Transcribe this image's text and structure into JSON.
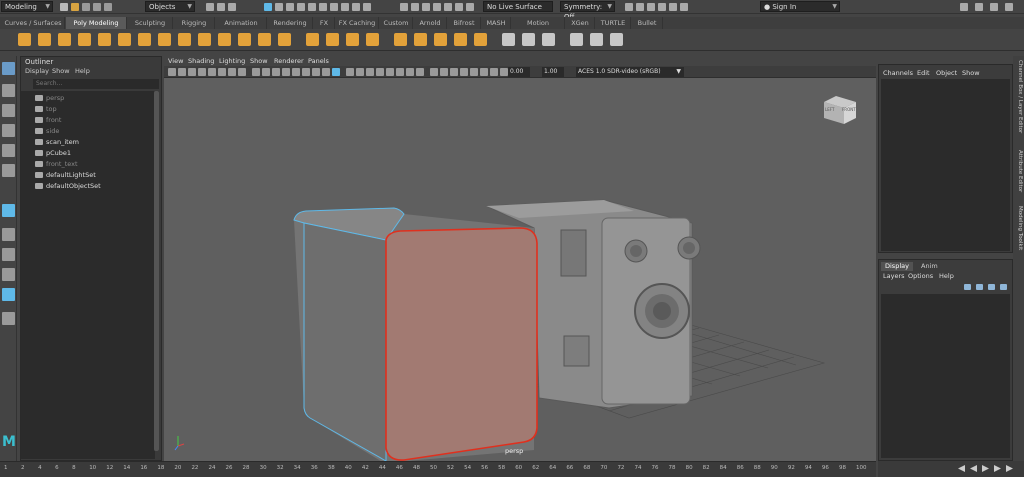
{
  "statusline": {
    "menuset": "Modeling",
    "selection_mode": "Objects",
    "live_surface": "No Live Surface",
    "symmetry": "Symmetry: Off",
    "sign_in": "Sign In"
  },
  "shelf_tabs": [
    "Curves / Surfaces",
    "Poly Modeling",
    "Sculpting",
    "Rigging",
    "Animation",
    "Rendering",
    "FX",
    "FX Caching",
    "Custom",
    "Arnold",
    "Bifrost",
    "MASH",
    "Motion Graphics",
    "XGen",
    "TURTLE",
    "Bullet"
  ],
  "shelf_active": "Poly Modeling",
  "outliner": {
    "title": "Outliner",
    "menu": [
      "Display",
      "Show",
      "Help"
    ],
    "search_placeholder": "Search...",
    "items": [
      {
        "label": "persp",
        "dim": true
      },
      {
        "label": "top",
        "dim": true
      },
      {
        "label": "front",
        "dim": true
      },
      {
        "label": "side",
        "dim": true
      },
      {
        "label": "scan_item",
        "dim": false
      },
      {
        "label": "pCube1",
        "dim": false
      },
      {
        "label": "front_text",
        "dim": true
      },
      {
        "label": "defaultLightSet",
        "dim": false
      },
      {
        "label": "defaultObjectSet",
        "dim": false
      }
    ]
  },
  "viewport": {
    "menu": [
      "View",
      "Shading",
      "Lighting",
      "Show",
      "Renderer",
      "Panels"
    ],
    "exposure": "0.00",
    "gamma": "1.00",
    "color_space": "ACES 1.0 SDR-video (sRGB)",
    "camera_label": "persp",
    "viewcube": {
      "left": "LEFT",
      "front": "FRONT"
    }
  },
  "channelbox": {
    "menu": [
      "Channels",
      "Edit",
      "Object",
      "Show"
    ]
  },
  "layers": {
    "tabs": [
      "Display",
      "Anim"
    ],
    "active_tab": "Display",
    "menu": [
      "Layers",
      "Options",
      "Help"
    ]
  },
  "side_tabs": [
    "Channel Box / Layer Editor",
    "Attribute Editor",
    "Modeling Toolkit"
  ],
  "timeline": {
    "ticks": [
      "1",
      "2",
      "4",
      "6",
      "8",
      "10",
      "12",
      "14",
      "16",
      "18",
      "20",
      "22",
      "24",
      "26",
      "28",
      "30",
      "32",
      "34",
      "36",
      "38",
      "40",
      "42",
      "44",
      "46",
      "48",
      "50",
      "52",
      "54",
      "56",
      "58",
      "60",
      "62",
      "64",
      "66",
      "68",
      "70",
      "72",
      "74",
      "76",
      "78",
      "80",
      "82",
      "84",
      "86",
      "88",
      "90",
      "92",
      "94",
      "96",
      "98",
      "100"
    ]
  },
  "colors": {
    "accent": "#e3a23a",
    "selection_red": "#e0301e",
    "selection_cyan": "#5fb9e8",
    "viewport_bg": "#5f5f5f"
  }
}
